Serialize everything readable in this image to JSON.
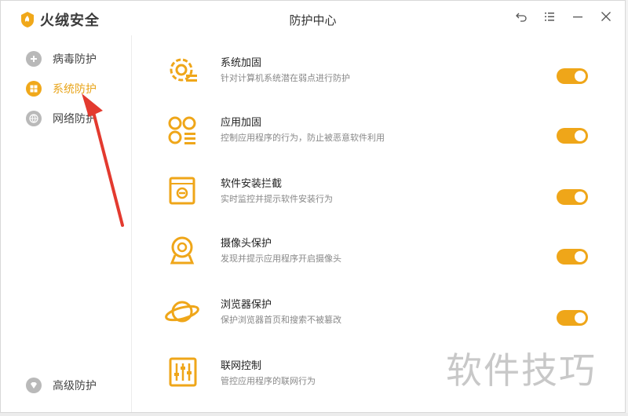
{
  "app": {
    "brand": "火绒安全",
    "window_title": "防护中心"
  },
  "sidebar": {
    "items": [
      {
        "label": "病毒防护",
        "icon": "shield-plus-icon",
        "active": false
      },
      {
        "label": "系统防护",
        "icon": "windows-icon",
        "active": true
      },
      {
        "label": "网络防护",
        "icon": "globe-icon",
        "active": false
      }
    ],
    "bottom_item": {
      "label": "高级防护",
      "icon": "diamond-icon"
    }
  },
  "features": [
    {
      "title": "系统加固",
      "desc": "针对计算机系统潜在弱点进行防护",
      "icon": "gear-lock-icon",
      "enabled": true
    },
    {
      "title": "应用加固",
      "desc": "控制应用程序的行为，防止被恶意软件利用",
      "icon": "app-grid-icon",
      "enabled": true
    },
    {
      "title": "软件安装拦截",
      "desc": "实时监控并提示软件安装行为",
      "icon": "install-box-icon",
      "enabled": true
    },
    {
      "title": "摄像头保护",
      "desc": "发现并提示应用程序开启摄像头",
      "icon": "webcam-icon",
      "enabled": true
    },
    {
      "title": "浏览器保护",
      "desc": "保护浏览器首页和搜索不被篡改",
      "icon": "planet-icon",
      "enabled": true
    },
    {
      "title": "联网控制",
      "desc": "管控应用程序的联网行为",
      "icon": "sliders-icon",
      "enabled": null
    }
  ],
  "watermark": "软件技巧",
  "colors": {
    "accent": "#efa619",
    "text": "#222222",
    "muted": "#888888"
  }
}
